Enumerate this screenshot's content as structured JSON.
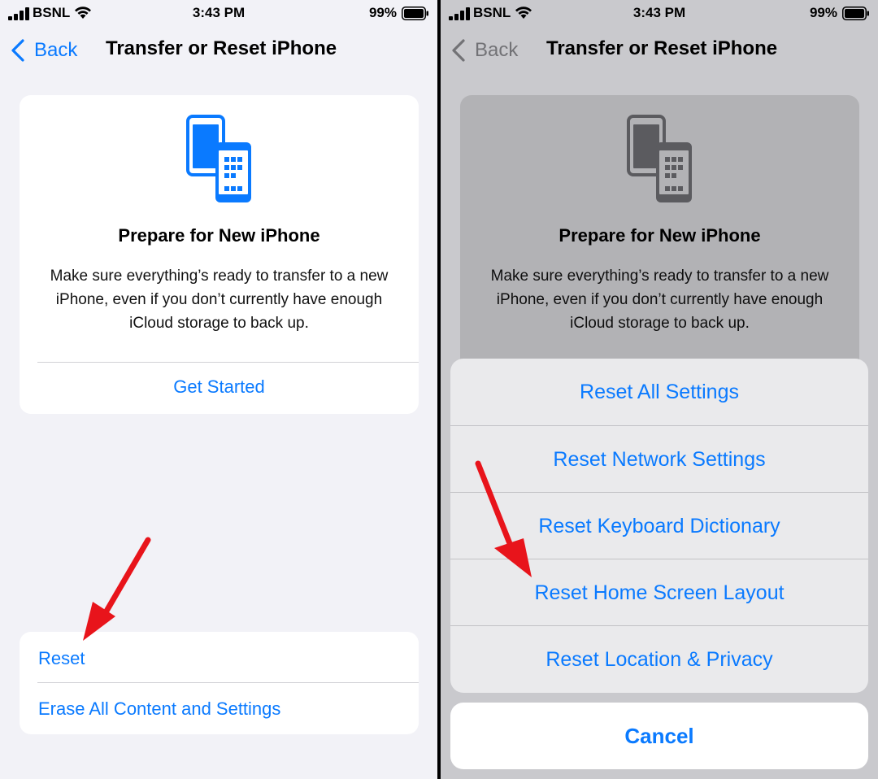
{
  "status_bar": {
    "carrier": "BSNL",
    "time": "3:43 PM",
    "battery": "99%"
  },
  "nav": {
    "back_label": "Back",
    "title": "Transfer or Reset iPhone"
  },
  "prepare_card": {
    "title": "Prepare for New iPhone",
    "description": "Make sure everything’s ready to transfer to a new iPhone, even if you don’t currently have enough iCloud storage to back up.",
    "action": "Get Started"
  },
  "reset_group": {
    "reset": "Reset",
    "erase": "Erase All Content and Settings"
  },
  "action_sheet": {
    "items": [
      "Reset All Settings",
      "Reset Network Settings",
      "Reset Keyboard Dictionary",
      "Reset Home Screen Layout",
      "Reset Location & Privacy"
    ],
    "cancel": "Cancel"
  },
  "colors": {
    "accent": "#0a7aff",
    "annotation_arrow": "#e8141b"
  }
}
